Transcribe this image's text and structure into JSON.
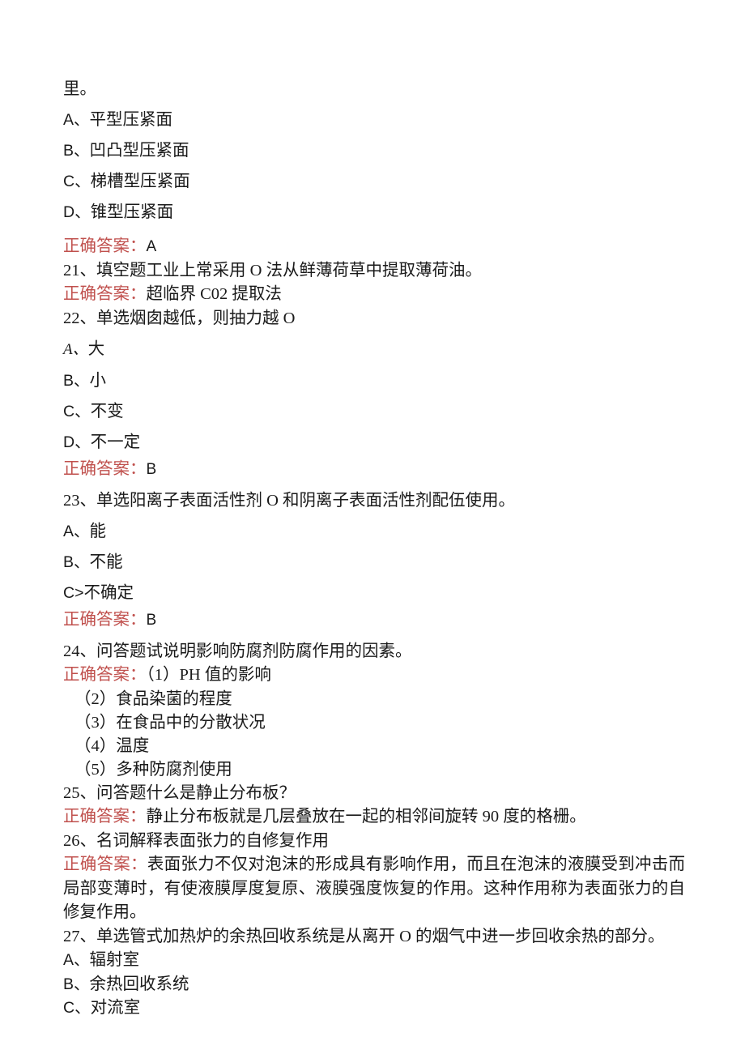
{
  "document": {
    "type": "exam-question-bank",
    "language": "zh-CN",
    "background_color": "#ffffff",
    "text_color": "#1a1a1a",
    "answer_label_color": "#c0504d"
  },
  "carryover": {
    "text": "里。"
  },
  "answer_label": "正确答案：",
  "questions": [
    {
      "id": "q20-options",
      "options": [
        {
          "letter": "A、",
          "text": "平型压紧面"
        },
        {
          "letter": "B、",
          "text": "凹凸型压紧面"
        },
        {
          "letter": "C、",
          "text": "梯槽型压紧面"
        },
        {
          "letter": "D、",
          "text": "锥型压紧面"
        }
      ],
      "answer": "A"
    },
    {
      "id": "q21",
      "number": "21、",
      "type_tag": "填空题",
      "stem": "工业上常采用 O 法从鲜薄荷草中提取薄荷油。",
      "full_stem": "21、填空题工业上常采用 O 法从鲜薄荷草中提取薄荷油。",
      "answer": "超临界 C02 提取法"
    },
    {
      "id": "q22",
      "number": "22、",
      "type_tag": "单选",
      "stem": "烟囱越低，则抽力越 O",
      "full_stem": "22、单选烟囱越低，则抽力越 O",
      "options": [
        {
          "letter": "A、",
          "text": "大",
          "style": "italic-letter"
        },
        {
          "letter": "B、",
          "text": "小"
        },
        {
          "letter": "C、",
          "text": "不变"
        },
        {
          "letter": "D、",
          "text": "不一定"
        }
      ],
      "answer": "B"
    },
    {
      "id": "q23",
      "number": "23、",
      "type_tag": "单选",
      "stem": "阳离子表面活性剂 O 和阴离子表面活性剂配伍使用。",
      "full_stem": "23、单选阳离子表面活性剂 O 和阴离子表面活性剂配伍使用。",
      "options": [
        {
          "letter": "A、",
          "text": "能"
        },
        {
          "letter": "B、",
          "text": "不能"
        },
        {
          "letter": "C>",
          "text": "不确定"
        }
      ],
      "answer": "B"
    },
    {
      "id": "q24",
      "number": "24、",
      "type_tag": "问答题",
      "stem": "试说明影响防腐剂防腐作用的因素。",
      "full_stem": "24、问答题试说明影响防腐剂防腐作用的因素。",
      "answer_first": "（1）PH 值的影响",
      "answer_items": [
        "（2）食品染菌的程度",
        "（3）在食品中的分散状况",
        "（4）温度",
        "（5）多种防腐剂使用"
      ]
    },
    {
      "id": "q25",
      "number": "25、",
      "type_tag": "问答题",
      "stem": "什么是静止分布板？",
      "full_stem": "25、问答题什么是静止分布板？",
      "answer": "静止分布板就是几层叠放在一起的相邻间旋转 90 度的格栅。"
    },
    {
      "id": "q26",
      "number": "26、",
      "type_tag": "名词解释",
      "stem": "表面张力的自修复作用",
      "full_stem": "26、名词解释表面张力的自修复作用",
      "answer": "表面张力不仅对泡沫的形成具有影响作用，而且在泡沫的液膜受到冲击而局部变薄时，有使液膜厚度复原、液膜强度恢复的作用。这种作用称为表面张力的自修复作用。"
    },
    {
      "id": "q27",
      "number": "27、",
      "type_tag": "单选",
      "stem": "管式加热炉的余热回收系统是从离开 O 的烟气中进一步回收余热的部分。",
      "full_stem": "27、单选管式加热炉的余热回收系统是从离开 O 的烟气中进一步回收余热的部分。",
      "options": [
        {
          "letter": "A、",
          "text": "辐射室"
        },
        {
          "letter": "B、",
          "text": "余热回收系统"
        },
        {
          "letter": "C、",
          "text": "对流室"
        }
      ]
    }
  ]
}
